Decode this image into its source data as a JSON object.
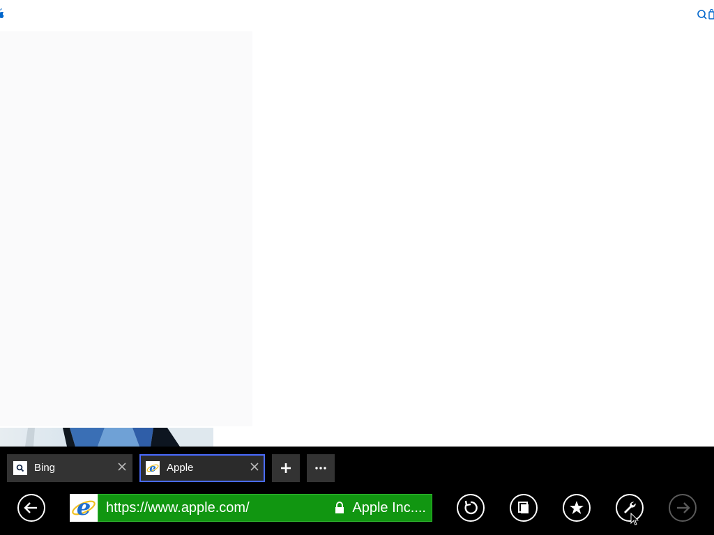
{
  "tabs": [
    {
      "label": "Bing",
      "favicon": "search-icon",
      "active": false
    },
    {
      "label": "Apple",
      "favicon": "ie-icon",
      "active": true
    }
  ],
  "address": {
    "url": "https://www.apple.com/",
    "security_label": "Apple Inc...."
  },
  "icons": {
    "back": "back-arrow-icon",
    "refresh": "refresh-icon",
    "pin": "pin-to-start-icon",
    "favorite": "star-icon",
    "tools": "wrench-icon",
    "forward": "forward-arrow-icon",
    "new_tab": "plus-icon",
    "tab_tools": "more-icon"
  },
  "colors": {
    "app_bar": "#000000",
    "url_field_secure": "#119611",
    "active_tab_border": "#4a6bff",
    "apple_link_blue": "#0066cc"
  }
}
